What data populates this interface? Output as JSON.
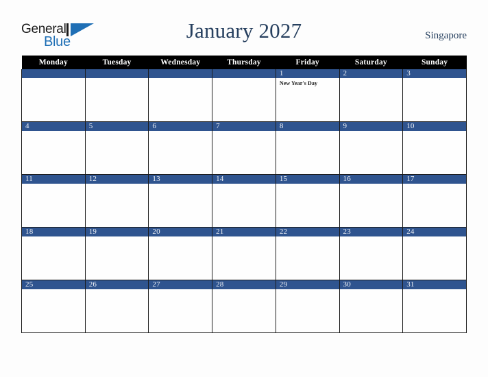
{
  "brand": {
    "word1": "General",
    "word2": "Blue",
    "logo_icon": "triangle-logo-icon",
    "dark_color": "#1a1a1a",
    "blue_color": "#1f6fb5"
  },
  "header": {
    "title": "January 2027",
    "location": "Singapore",
    "title_color": "#27405f"
  },
  "calendar": {
    "weekday_headers": [
      "Monday",
      "Tuesday",
      "Wednesday",
      "Thursday",
      "Friday",
      "Saturday",
      "Sunday"
    ],
    "header_bg": "#000000",
    "daybar_bg": "#2f548f",
    "cell_bg": "#fefefe",
    "border_color": "#1b1b1b",
    "weeks": [
      [
        {
          "date": "",
          "event": ""
        },
        {
          "date": "",
          "event": ""
        },
        {
          "date": "",
          "event": ""
        },
        {
          "date": "",
          "event": ""
        },
        {
          "date": "1",
          "event": "New Year's Day"
        },
        {
          "date": "2",
          "event": ""
        },
        {
          "date": "3",
          "event": ""
        }
      ],
      [
        {
          "date": "4",
          "event": ""
        },
        {
          "date": "5",
          "event": ""
        },
        {
          "date": "6",
          "event": ""
        },
        {
          "date": "7",
          "event": ""
        },
        {
          "date": "8",
          "event": ""
        },
        {
          "date": "9",
          "event": ""
        },
        {
          "date": "10",
          "event": ""
        }
      ],
      [
        {
          "date": "11",
          "event": ""
        },
        {
          "date": "12",
          "event": ""
        },
        {
          "date": "13",
          "event": ""
        },
        {
          "date": "14",
          "event": ""
        },
        {
          "date": "15",
          "event": ""
        },
        {
          "date": "16",
          "event": ""
        },
        {
          "date": "17",
          "event": ""
        }
      ],
      [
        {
          "date": "18",
          "event": ""
        },
        {
          "date": "19",
          "event": ""
        },
        {
          "date": "20",
          "event": ""
        },
        {
          "date": "21",
          "event": ""
        },
        {
          "date": "22",
          "event": ""
        },
        {
          "date": "23",
          "event": ""
        },
        {
          "date": "24",
          "event": ""
        }
      ],
      [
        {
          "date": "25",
          "event": ""
        },
        {
          "date": "26",
          "event": ""
        },
        {
          "date": "27",
          "event": ""
        },
        {
          "date": "28",
          "event": ""
        },
        {
          "date": "29",
          "event": ""
        },
        {
          "date": "30",
          "event": ""
        },
        {
          "date": "31",
          "event": ""
        }
      ]
    ]
  }
}
